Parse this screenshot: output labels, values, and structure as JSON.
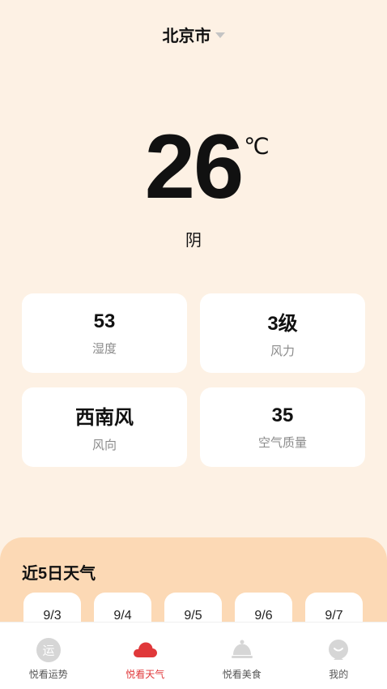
{
  "header": {
    "city": "北京市"
  },
  "current": {
    "temperature": "26",
    "unit": "℃",
    "condition": "阴"
  },
  "stats": [
    {
      "value": "53",
      "label": "湿度"
    },
    {
      "value": "3级",
      "label": "风力"
    },
    {
      "value": "西南风",
      "label": "风向"
    },
    {
      "value": "35",
      "label": "空气质量"
    }
  ],
  "forecast": {
    "title": "近5日天气",
    "days": [
      {
        "date": "9/3"
      },
      {
        "date": "9/4"
      },
      {
        "date": "9/5"
      },
      {
        "date": "9/6"
      },
      {
        "date": "9/7"
      }
    ]
  },
  "tabbar": {
    "items": [
      {
        "label": "悦看运势",
        "icon": "fortune-icon",
        "glyph": "运"
      },
      {
        "label": "悦看天气",
        "icon": "cloud-icon",
        "active": true
      },
      {
        "label": "悦看美食",
        "icon": "food-cloche-icon"
      },
      {
        "label": "我的",
        "icon": "profile-icon"
      }
    ]
  },
  "colors": {
    "background": "#FDF1E4",
    "forecast_panel": "#FCD9B5",
    "active_tab": "#E0383A",
    "inactive_icon": "#D6D6D6"
  }
}
